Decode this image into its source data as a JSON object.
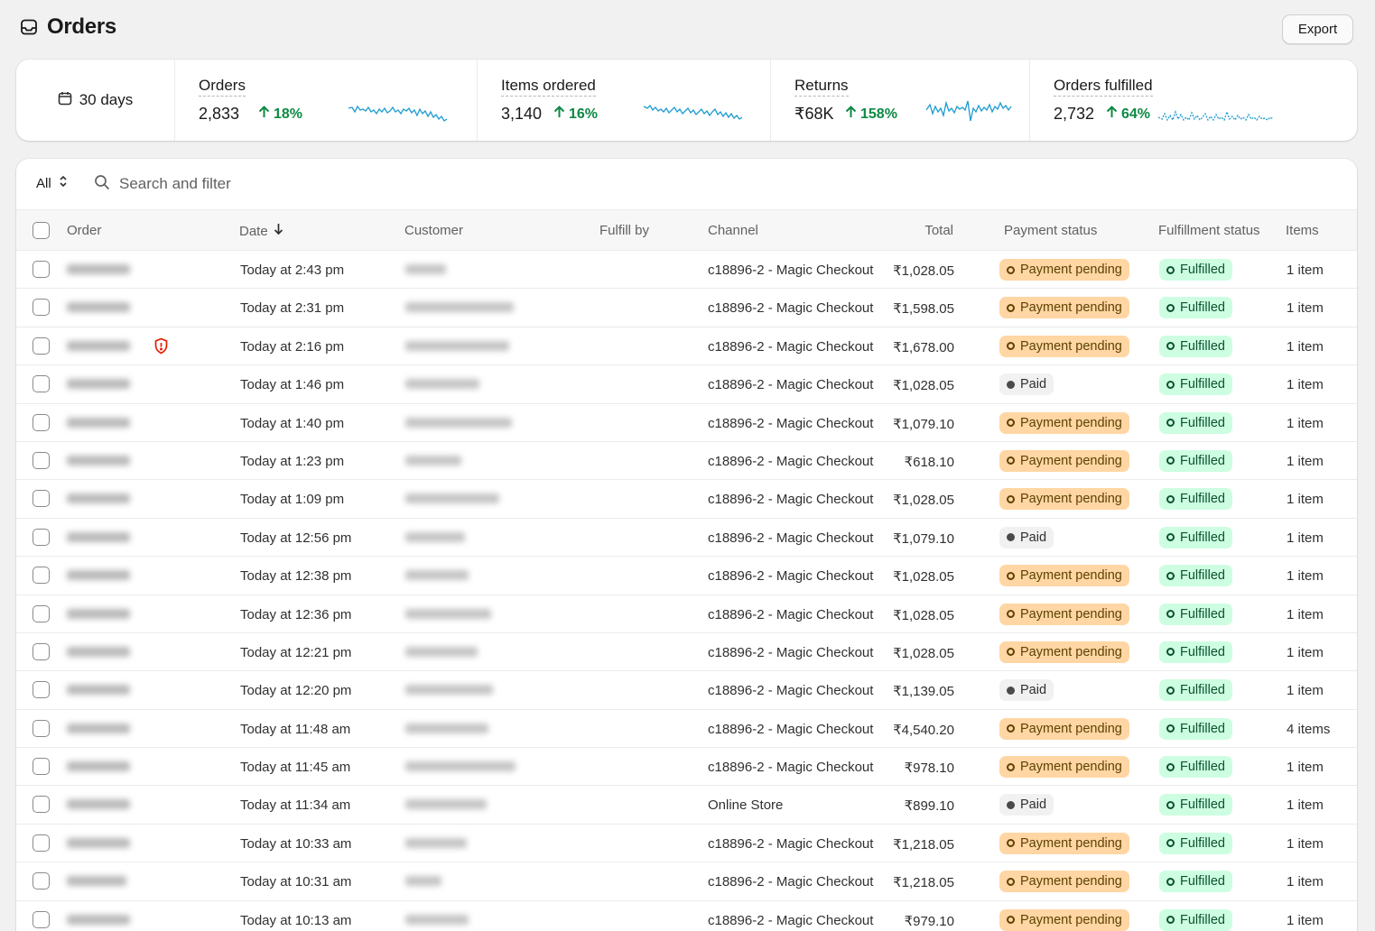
{
  "header": {
    "title": "Orders",
    "title_icon": "orders-inbox-icon",
    "export_label": "Export"
  },
  "stats": {
    "period_label": "30 days",
    "cards": [
      {
        "label": "Orders",
        "value": "2,833",
        "change": "18%",
        "trend": "up"
      },
      {
        "label": "Items ordered",
        "value": "3,140",
        "change": "16%",
        "trend": "up"
      },
      {
        "label": "Returns",
        "value": "₹68K",
        "change": "158%",
        "trend": "up"
      },
      {
        "label": "Orders fulfilled",
        "value": "2,732",
        "change": "64%",
        "trend": "up"
      }
    ],
    "positive_color": "#0c8a43",
    "sparkline_color": "#1d9bd1"
  },
  "filter": {
    "view_label": "All",
    "search_placeholder": "Search and filter"
  },
  "table": {
    "columns": {
      "order": "Order",
      "date": "Date",
      "customer": "Customer",
      "fulfill_by": "Fulfill by",
      "channel": "Channel",
      "total": "Total",
      "payment_status": "Payment status",
      "fulfillment_status": "Fulfillment status",
      "items": "Items"
    },
    "sort": {
      "column": "Date",
      "direction": "descending"
    },
    "rows": [
      {
        "order": "",
        "date": "Today at 2:43 pm",
        "customer": "",
        "channel": "c18896-2 - Magic Checkout",
        "total": "₹1,028.05",
        "payment": "Payment pending",
        "payment_kind": "pending",
        "fulfillment": "Fulfilled",
        "items": "1 item",
        "alert": false
      },
      {
        "order": "",
        "date": "Today at 2:31 pm",
        "customer": "",
        "channel": "c18896-2 - Magic Checkout",
        "total": "₹1,598.05",
        "payment": "Payment pending",
        "payment_kind": "pending",
        "fulfillment": "Fulfilled",
        "items": "1 item",
        "alert": false
      },
      {
        "order": "",
        "date": "Today at 2:16 pm",
        "customer": "",
        "channel": "c18896-2 - Magic Checkout",
        "total": "₹1,678.00",
        "payment": "Payment pending",
        "payment_kind": "pending",
        "fulfillment": "Fulfilled",
        "items": "1 item",
        "alert": true
      },
      {
        "order": "",
        "date": "Today at 1:46 pm",
        "customer": "",
        "channel": "c18896-2 - Magic Checkout",
        "total": "₹1,028.05",
        "payment": "Paid",
        "payment_kind": "paid",
        "fulfillment": "Fulfilled",
        "items": "1 item",
        "alert": false
      },
      {
        "order": "",
        "date": "Today at 1:40 pm",
        "customer": "",
        "channel": "c18896-2 - Magic Checkout",
        "total": "₹1,079.10",
        "payment": "Payment pending",
        "payment_kind": "pending",
        "fulfillment": "Fulfilled",
        "items": "1 item",
        "alert": false
      },
      {
        "order": "",
        "date": "Today at 1:23 pm",
        "customer": "",
        "channel": "c18896-2 - Magic Checkout",
        "total": "₹618.10",
        "payment": "Payment pending",
        "payment_kind": "pending",
        "fulfillment": "Fulfilled",
        "items": "1 item",
        "alert": false
      },
      {
        "order": "",
        "date": "Today at 1:09 pm",
        "customer": "",
        "channel": "c18896-2 - Magic Checkout",
        "total": "₹1,028.05",
        "payment": "Payment pending",
        "payment_kind": "pending",
        "fulfillment": "Fulfilled",
        "items": "1 item",
        "alert": false
      },
      {
        "order": "",
        "date": "Today at 12:56 pm",
        "customer": "",
        "channel": "c18896-2 - Magic Checkout",
        "total": "₹1,079.10",
        "payment": "Paid",
        "payment_kind": "paid",
        "fulfillment": "Fulfilled",
        "items": "1 item",
        "alert": false
      },
      {
        "order": "",
        "date": "Today at 12:38 pm",
        "customer": "",
        "channel": "c18896-2 - Magic Checkout",
        "total": "₹1,028.05",
        "payment": "Payment pending",
        "payment_kind": "pending",
        "fulfillment": "Fulfilled",
        "items": "1 item",
        "alert": false
      },
      {
        "order": "",
        "date": "Today at 12:36 pm",
        "customer": "",
        "channel": "c18896-2 - Magic Checkout",
        "total": "₹1,028.05",
        "payment": "Payment pending",
        "payment_kind": "pending",
        "fulfillment": "Fulfilled",
        "items": "1 item",
        "alert": false
      },
      {
        "order": "",
        "date": "Today at 12:21 pm",
        "customer": "",
        "channel": "c18896-2 - Magic Checkout",
        "total": "₹1,028.05",
        "payment": "Payment pending",
        "payment_kind": "pending",
        "fulfillment": "Fulfilled",
        "items": "1 item",
        "alert": false
      },
      {
        "order": "",
        "date": "Today at 12:20 pm",
        "customer": "",
        "channel": "c18896-2 - Magic Checkout",
        "total": "₹1,139.05",
        "payment": "Paid",
        "payment_kind": "paid",
        "fulfillment": "Fulfilled",
        "items": "1 item",
        "alert": false
      },
      {
        "order": "",
        "date": "Today at 11:48 am",
        "customer": "",
        "channel": "c18896-2 - Magic Checkout",
        "total": "₹4,540.20",
        "payment": "Payment pending",
        "payment_kind": "pending",
        "fulfillment": "Fulfilled",
        "items": "4 items",
        "alert": false
      },
      {
        "order": "",
        "date": "Today at 11:45 am",
        "customer": "",
        "channel": "c18896-2 - Magic Checkout",
        "total": "₹978.10",
        "payment": "Payment pending",
        "payment_kind": "pending",
        "fulfillment": "Fulfilled",
        "items": "1 item",
        "alert": false
      },
      {
        "order": "",
        "date": "Today at 11:34 am",
        "customer": "",
        "channel": "Online Store",
        "total": "₹899.10",
        "payment": "Paid",
        "payment_kind": "paid",
        "fulfillment": "Fulfilled",
        "items": "1 item",
        "alert": false
      },
      {
        "order": "",
        "date": "Today at 10:33 am",
        "customer": "",
        "channel": "c18896-2 - Magic Checkout",
        "total": "₹1,218.05",
        "payment": "Payment pending",
        "payment_kind": "pending",
        "fulfillment": "Fulfilled",
        "items": "1 item",
        "alert": false
      },
      {
        "order": "",
        "date": "Today at 10:31 am",
        "customer": "",
        "channel": "c18896-2 - Magic Checkout",
        "total": "₹1,218.05",
        "payment": "Payment pending",
        "payment_kind": "pending",
        "fulfillment": "Fulfilled",
        "items": "1 item",
        "alert": false
      },
      {
        "order": "",
        "date": "Today at 10:13 am",
        "customer": "",
        "channel": "c18896-2 - Magic Checkout",
        "total": "₹979.10",
        "payment": "Payment pending",
        "payment_kind": "pending",
        "fulfillment": "Fulfilled",
        "items": "1 item",
        "alert": false
      }
    ]
  },
  "colors": {
    "pending_bg": "#ffd6a4",
    "fulfilled_bg": "#cdfee1",
    "paid_bg": "#f1f1f1",
    "alert": "#e51c00"
  }
}
